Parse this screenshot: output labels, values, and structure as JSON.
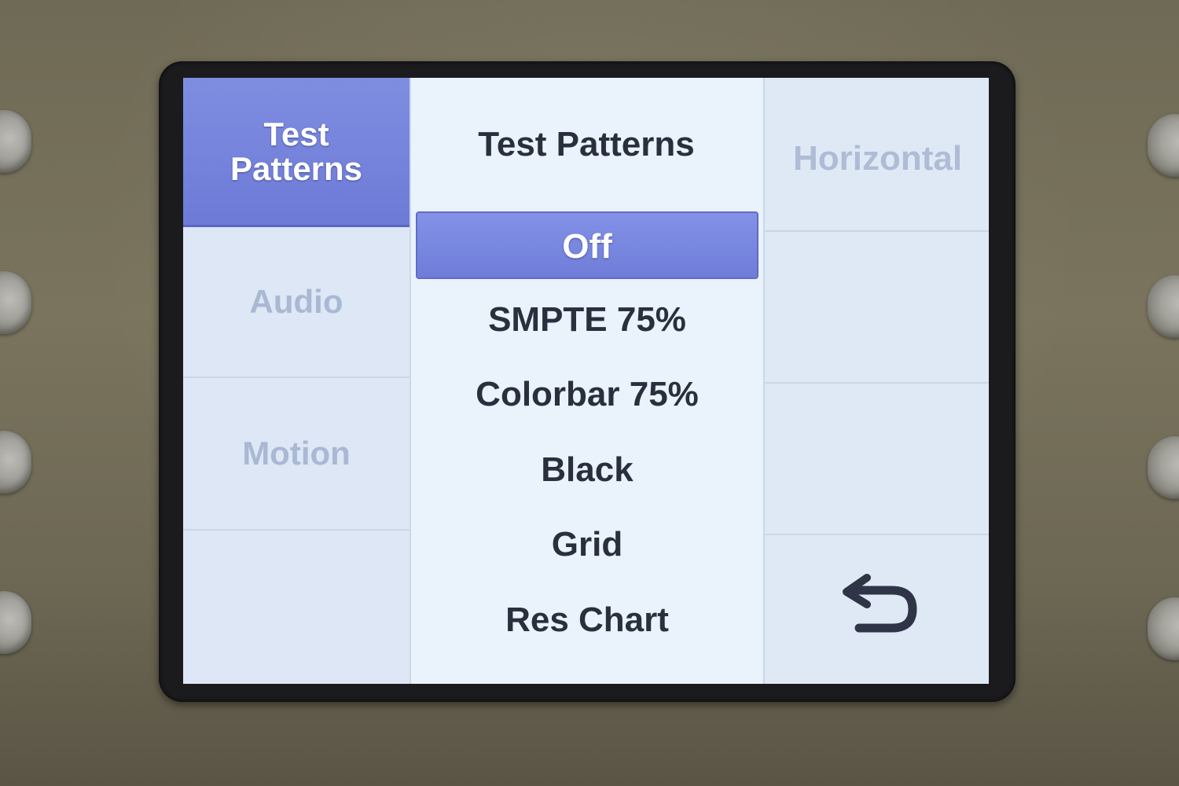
{
  "sidebar": {
    "tabs": [
      {
        "label_line1": "Test",
        "label_line2": "Patterns",
        "active": true
      },
      {
        "label": "Audio",
        "active": false
      },
      {
        "label": "Motion",
        "active": false
      },
      {
        "label": "",
        "active": false
      }
    ]
  },
  "main": {
    "title": "Test Patterns",
    "options": [
      {
        "label": "Off",
        "selected": true
      },
      {
        "label": "SMPTE 75%",
        "selected": false
      },
      {
        "label": "Colorbar 75%",
        "selected": false
      },
      {
        "label": "Black",
        "selected": false
      },
      {
        "label": "Grid",
        "selected": false
      },
      {
        "label": "Res Chart",
        "selected": false
      }
    ]
  },
  "right_panel": {
    "header_label": "Horizontal",
    "back_icon": "back-arrow-icon"
  },
  "colors": {
    "selected": "#7583dc",
    "text": "#2a2f3e",
    "inactive_text": "#a9b8d3",
    "screen_bg": "#e9f1fb"
  }
}
